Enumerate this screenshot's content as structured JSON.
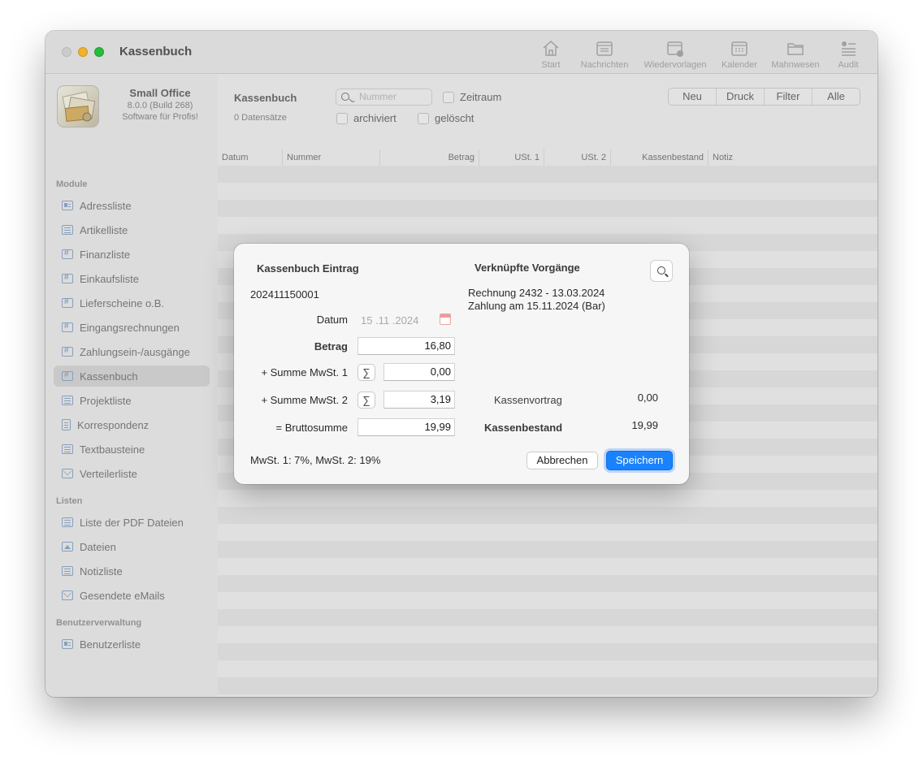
{
  "window": {
    "title": "Kassenbuch"
  },
  "toolbar": {
    "items": [
      {
        "label": "Start",
        "icon": "house-icon"
      },
      {
        "label": "Nachrichten",
        "icon": "inbox-icon"
      },
      {
        "label": "Wiedervorlagen",
        "icon": "calendar-clock-icon"
      },
      {
        "label": "Kalender",
        "icon": "calendar-icon"
      },
      {
        "label": "Mahnwesen",
        "icon": "folder-icon"
      },
      {
        "label": "Audit",
        "icon": "checklist-icon"
      }
    ]
  },
  "app": {
    "name": "Small Office",
    "version": "8.0.0 (Build 268)",
    "slogan": "Software für Profis!"
  },
  "sidebar": {
    "sections": [
      {
        "title": "Module",
        "items": [
          {
            "label": "Adressliste",
            "icon": "card-icon"
          },
          {
            "label": "Artikelliste",
            "icon": "list-icon"
          },
          {
            "label": "Finanzliste",
            "icon": "hash-icon"
          },
          {
            "label": "Einkaufsliste",
            "icon": "hash-icon"
          },
          {
            "label": "Lieferscheine o.B.",
            "icon": "hash-icon"
          },
          {
            "label": "Eingangsrechnungen",
            "icon": "hash-icon"
          },
          {
            "label": "Zahlungsein-/ausgänge",
            "icon": "hash-icon"
          },
          {
            "label": "Kassenbuch",
            "icon": "hash-icon",
            "selected": true
          },
          {
            "label": "Projektliste",
            "icon": "list-icon"
          },
          {
            "label": "Korrespondenz",
            "icon": "document-icon"
          },
          {
            "label": "Textbausteine",
            "icon": "list-icon"
          },
          {
            "label": "Verteilerliste",
            "icon": "envelope-icon"
          }
        ]
      },
      {
        "title": "Listen",
        "items": [
          {
            "label": "Liste der PDF Dateien",
            "icon": "list-icon"
          },
          {
            "label": "Dateien",
            "icon": "image-icon"
          },
          {
            "label": "Notizliste",
            "icon": "list-icon"
          },
          {
            "label": "Gesendete eMails",
            "icon": "envelope-icon"
          }
        ]
      },
      {
        "title": "Benutzerverwaltung",
        "items": [
          {
            "label": "Benutzerliste",
            "icon": "card-icon"
          }
        ]
      }
    ]
  },
  "main": {
    "title": "Kassenbuch",
    "record_count": "0 Datensätze",
    "search_placeholder": "Nummer",
    "filters": {
      "zeitraum": "Zeitraum",
      "archiviert": "archiviert",
      "geloescht": "gelöscht"
    },
    "segment": [
      "Neu",
      "Druck",
      "Filter",
      "Alle"
    ],
    "columns": [
      "Datum",
      "Nummer",
      "Betrag",
      "USt. 1",
      "USt. 2",
      "Kassenbestand",
      "Notiz"
    ]
  },
  "dialog": {
    "title": "Kassenbuch Eintrag",
    "entry_number": "202411150001",
    "linked_title": "Verknüpfte Vorgänge",
    "linked_items": [
      "Rechnung 2432 - 13.03.2024",
      "Zahlung am 15.11.2024 (Bar)"
    ],
    "datum_label": "Datum",
    "datum_value": "15 .11 .2024",
    "betrag_label": "Betrag",
    "betrag_value": "16,80",
    "mwst1_label": "+ Summe MwSt. 1",
    "mwst1_value": "0,00",
    "mwst2_label": "+ Summe MwSt. 2",
    "mwst2_value": "3,19",
    "brutto_label": "= Bruttosumme",
    "brutto_value": "19,99",
    "sum_symbol": "∑",
    "kassenvortrag_label": "Kassenvortrag",
    "kassenvortrag_value": "0,00",
    "kassenbestand_label": "Kassenbestand",
    "kassenbestand_value": "19,99",
    "footer_note": "MwSt. 1: 7%, MwSt. 2: 19%",
    "cancel_label": "Abbrechen",
    "save_label": "Speichern",
    "accent_color": "#1a82fb"
  }
}
